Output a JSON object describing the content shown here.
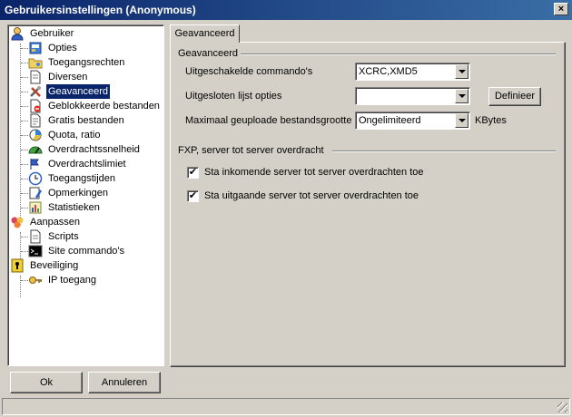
{
  "window": {
    "title": "Gebruikersinstellingen (Anonymous)",
    "close_symbol": "×"
  },
  "tree": [
    {
      "label": "Gebruiker",
      "icon": "user-icon",
      "level": 0
    },
    {
      "label": "Opties",
      "icon": "options-icon",
      "level": 1
    },
    {
      "label": "Toegangsrechten",
      "icon": "folder-key-icon",
      "level": 1
    },
    {
      "label": "Diversen",
      "icon": "document-icon",
      "level": 1
    },
    {
      "label": "Geavanceerd",
      "icon": "tools-icon",
      "level": 1,
      "selected": true
    },
    {
      "label": "Geblokkeerde bestanden",
      "icon": "blocked-files-icon",
      "level": 1
    },
    {
      "label": "Gratis bestanden",
      "icon": "free-files-icon",
      "level": 1
    },
    {
      "label": "Quota, ratio",
      "icon": "quota-icon",
      "level": 1
    },
    {
      "label": "Overdrachtssnelheid",
      "icon": "speed-gauge-icon",
      "level": 1
    },
    {
      "label": "Overdrachtslimiet",
      "icon": "limit-icon",
      "level": 1
    },
    {
      "label": "Toegangstijden",
      "icon": "clock-icon",
      "level": 1
    },
    {
      "label": "Opmerkingen",
      "icon": "notes-icon",
      "level": 1
    },
    {
      "label": "Statistieken",
      "icon": "statistics-icon",
      "level": 1
    },
    {
      "label": "Aanpassen",
      "icon": "customize-icon",
      "level": 0
    },
    {
      "label": "Scripts",
      "icon": "script-icon",
      "level": 1
    },
    {
      "label": "Site commando's",
      "icon": "console-icon",
      "level": 1
    },
    {
      "label": "Beveiliging",
      "icon": "security-icon",
      "level": 0
    },
    {
      "label": "IP toegang",
      "icon": "ip-key-icon",
      "level": 1
    }
  ],
  "buttons": {
    "ok": "Ok",
    "cancel": "Annuleren",
    "define": "Definieer"
  },
  "tab": {
    "label": "Geavanceerd"
  },
  "advanced": {
    "group_title": "Geavanceerd",
    "disabled_commands_label": "Uitgeschakelde commando's",
    "disabled_commands_value": "XCRC,XMD5",
    "excluded_list_label": "Uitgesloten lijst opties",
    "excluded_list_value": "",
    "max_upload_label": "Maximaal geuploade bestandsgrootte",
    "max_upload_value": "Ongelimiteerd",
    "max_upload_unit": "KBytes"
  },
  "fxp": {
    "group_title": "FXP, server tot server overdracht",
    "incoming_label": "Sta inkomende server tot server overdrachten toe",
    "incoming_checked": true,
    "outgoing_label": "Sta uitgaande server tot server overdrachten toe",
    "outgoing_checked": true,
    "check_symbol": "✔"
  }
}
